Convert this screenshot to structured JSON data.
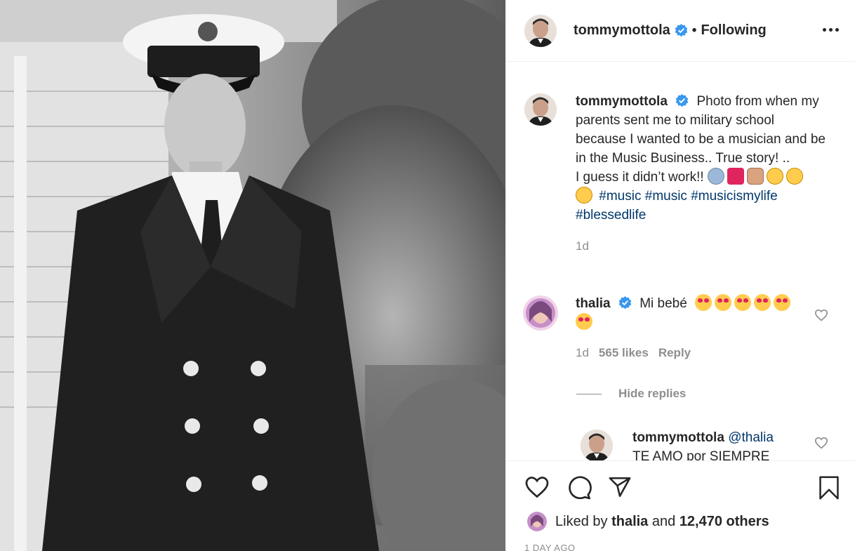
{
  "header": {
    "username": "tommymottola",
    "separator": "•",
    "follow_status": "Following"
  },
  "caption": {
    "username": "tommymottola",
    "text_line1": "Photo from when my parents sent me to military school because I wanted to be a musician and be in the Music Business.. True story! ..",
    "text_line2": "I guess it didn’t work!!",
    "hashtags": [
      "#music",
      "#music",
      "#musicismylife",
      "#blessedlife"
    ],
    "time": "1d"
  },
  "comments": [
    {
      "username": "thalia",
      "text": "Mi bebé",
      "time": "1d",
      "likes": "565 likes",
      "reply_label": "Reply"
    }
  ],
  "hide_replies_label": "Hide replies",
  "reply": {
    "username": "tommymottola",
    "mention": "@thalia",
    "text_partial": "TE AMO por SIEMPRE"
  },
  "likes": {
    "prefix": "Liked by",
    "user": "thalia",
    "middle": "and",
    "count": "12,470 others"
  },
  "timestamp": "1 DAY AGO",
  "colors": {
    "verified": "#3897f0",
    "hashtag": "#00376b",
    "muted": "#8e8e8e",
    "heart_red": "#e0245e"
  },
  "icons": [
    "like-icon",
    "comment-icon",
    "share-icon",
    "save-icon",
    "more-options-icon",
    "verified-icon"
  ]
}
